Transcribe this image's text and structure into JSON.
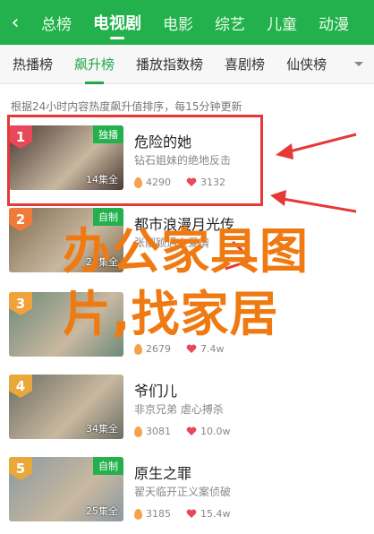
{
  "topnav": {
    "back_icon": "chevron-left-icon",
    "tabs": [
      {
        "label": "总榜",
        "active": false
      },
      {
        "label": "电视剧",
        "active": true
      },
      {
        "label": "电影",
        "active": false
      },
      {
        "label": "综艺",
        "active": false
      },
      {
        "label": "儿童",
        "active": false
      },
      {
        "label": "动漫",
        "active": false
      }
    ]
  },
  "subnav": {
    "tabs": [
      {
        "label": "热播榜",
        "active": false
      },
      {
        "label": "飙升榜",
        "active": true
      },
      {
        "label": "播放指数榜",
        "active": false
      },
      {
        "label": "喜剧榜",
        "active": false
      },
      {
        "label": "仙侠榜",
        "active": false
      }
    ],
    "more_icon": "chevron-down-icon"
  },
  "hint": "根据24小时内容热度飙升值排序，每15分钟更新",
  "items": [
    {
      "rank": "1",
      "rank_color": "#e8485a",
      "badge": "独播",
      "episodes": "14集全",
      "title": "危险的她",
      "desc": "钻石姐妹的绝地反击",
      "heat": "4290",
      "likes": "3132",
      "thumb_color": "#4a3a34"
    },
    {
      "rank": "2",
      "rank_color": "#f07a3a",
      "badge": "自制",
      "episodes": "25集全",
      "title": "都市浪漫月光传",
      "desc": "张靓颖遇上爱情",
      "heat": "",
      "likes": "",
      "thumb_color": "#7d6a4e"
    },
    {
      "rank": "3",
      "rank_color": "#f2a23a",
      "badge": "",
      "episodes": "",
      "title": "",
      "desc": "",
      "heat": "2679",
      "likes": "7.4w",
      "thumb_color": "#6c8a7a"
    },
    {
      "rank": "4",
      "rank_color": "#e8a83a",
      "badge": "",
      "episodes": "34集全",
      "title": "爷们儿",
      "desc": "非京兄弟 虐心搏杀",
      "heat": "3081",
      "likes": "10.0w",
      "thumb_color": "#6b6e63"
    },
    {
      "rank": "5",
      "rank_color": "#e8a83a",
      "badge": "自制",
      "episodes": "25集全",
      "title": "原生之罪",
      "desc": "翟天临开正义案侦破",
      "heat": "3185",
      "likes": "15.4w",
      "thumb_color": "#8a9aa0"
    }
  ],
  "watermark": {
    "line1": "办公家具图",
    "line2": "片,找家居"
  },
  "colors": {
    "primary": "#22b14c",
    "annotation": "#e53935",
    "watermark": "#f07a12"
  }
}
